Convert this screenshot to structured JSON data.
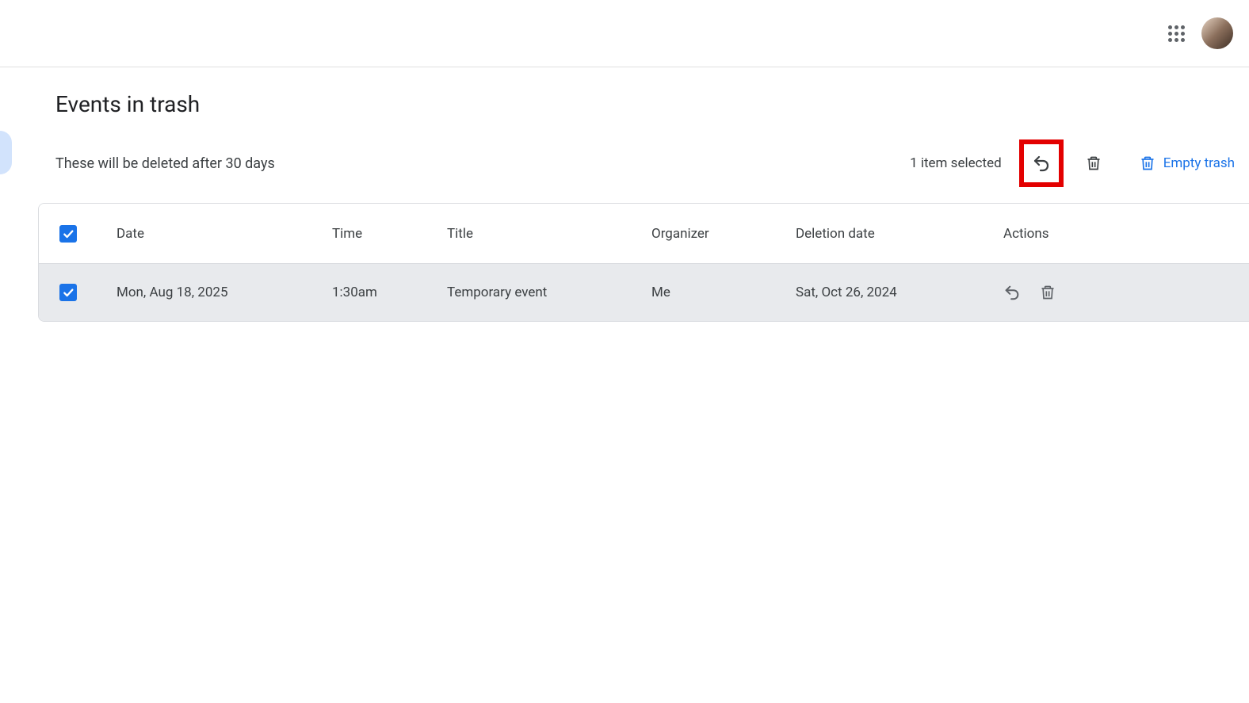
{
  "header": {},
  "page": {
    "title": "Events in trash",
    "subtitle": "These will be deleted after 30 days",
    "selected_text": "1 item selected",
    "empty_trash_label": "Empty trash"
  },
  "table": {
    "columns": {
      "date": "Date",
      "time": "Time",
      "title": "Title",
      "organizer": "Organizer",
      "deletion_date": "Deletion date",
      "actions": "Actions"
    },
    "rows": [
      {
        "date": "Mon, Aug 18, 2025",
        "time": "1:30am",
        "title": "Temporary event",
        "organizer": "Me",
        "deletion_date": "Sat, Oct 26, 2024"
      }
    ]
  }
}
